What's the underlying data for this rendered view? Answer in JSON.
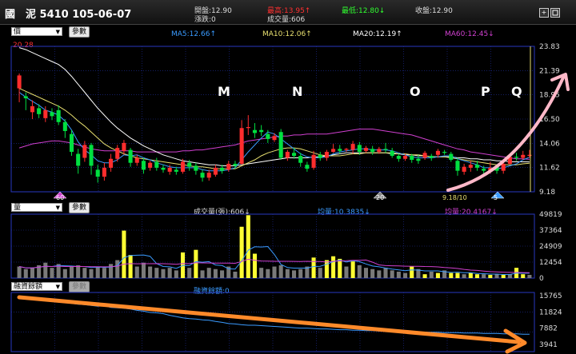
{
  "header": {
    "title": "國　泥 5410 105-06-07",
    "open_label": "開盤:",
    "open": "12.90",
    "high_label": "最高:",
    "high": "13.95↑",
    "low_label": "最低:",
    "low": "12.80↓",
    "close_label": "收盤:",
    "close": "12.90",
    "change_label": "漲跌:",
    "change": "0",
    "volume_label": "成交量:",
    "volume": "606",
    "plus_icon": "+",
    "restore_icon": "restore-icon"
  },
  "panel_price": {
    "selector": "價",
    "param_button": "參數",
    "ma5": "MA5:12.66↑",
    "ma10": "MA10:12.06↑",
    "ma20": "MA20:12.19↑",
    "ma60": "MA60:12.45↓",
    "top_left_value": "20.28",
    "y_ticks": [
      "23.83",
      "21.39",
      "18.95",
      "16.50",
      "14.06",
      "11.62",
      "9.18"
    ],
    "markers": {
      "left": "60",
      "mid": "20",
      "right": "5"
    },
    "low_label": "9.18/10",
    "letters": [
      "M",
      "N",
      "O",
      "P",
      "Q"
    ]
  },
  "panel_volume": {
    "selector": "量",
    "param_button": "參數",
    "vol_label": "成交量(張):606↓",
    "avg_short": "均量:10.3835↓",
    "avg_long": "均量:20.4167↓",
    "y_ticks": [
      "49819",
      "37364",
      "24909",
      "12454",
      "0"
    ]
  },
  "panel_margin": {
    "selector": "融資餘額",
    "param_button": "參數",
    "label": "融資餘額:0",
    "y_ticks": [
      "15765",
      "11824",
      "7882",
      "3941"
    ]
  },
  "colors": {
    "up": "#ff2d2d",
    "down": "#00e040",
    "ma5": "#3a9bff",
    "ma10": "#e8e070",
    "ma20": "#ffffff",
    "ma60": "#d040d0",
    "vol_hi": "#ffff33",
    "vol": "#7a7a7a",
    "grid": "#2030a0"
  },
  "chart_data": {
    "type": "candlestick",
    "y_range": [
      9.18,
      23.83
    ],
    "candles": [
      [
        19.6,
        20.9,
        21.1,
        18.2
      ],
      [
        18.8,
        18.6,
        19.2,
        17.4
      ],
      [
        17.2,
        17.8,
        18.4,
        16.5
      ],
      [
        17.6,
        17.0,
        18.0,
        16.6
      ],
      [
        16.6,
        17.4,
        17.8,
        16.2
      ],
      [
        17.2,
        16.8,
        17.6,
        16.4
      ],
      [
        17.4,
        16.2,
        17.9,
        15.9
      ],
      [
        16.2,
        15.3,
        16.5,
        14.6
      ],
      [
        15.0,
        13.2,
        15.4,
        12.8
      ],
      [
        13.0,
        11.8,
        13.5,
        11.0
      ],
      [
        12.6,
        13.9,
        14.3,
        12.2
      ],
      [
        13.9,
        11.8,
        14.1,
        10.9
      ],
      [
        11.4,
        10.7,
        11.9,
        10.1
      ],
      [
        10.7,
        11.6,
        12.1,
        10.3
      ],
      [
        11.6,
        12.5,
        13.0,
        11.2
      ],
      [
        12.5,
        13.6,
        13.9,
        12.2
      ],
      [
        13.3,
        14.1,
        14.4,
        12.9
      ],
      [
        13.4,
        12.1,
        13.6,
        11.7
      ],
      [
        12.1,
        12.6,
        12.9,
        11.8
      ],
      [
        12.3,
        11.4,
        12.6,
        11.0
      ],
      [
        11.6,
        12.1,
        12.3,
        11.3
      ],
      [
        12.2,
        11.6,
        12.6,
        11.3
      ],
      [
        11.6,
        11.4,
        11.9,
        11.1
      ],
      [
        11.2,
        11.6,
        11.9,
        10.9
      ],
      [
        11.4,
        11.2,
        11.7,
        10.9
      ],
      [
        11.2,
        12.2,
        12.5,
        11.0
      ],
      [
        12.1,
        11.7,
        12.4,
        11.3
      ],
      [
        11.8,
        11.3,
        12.1,
        10.9
      ],
      [
        11.1,
        10.6,
        11.4,
        10.2
      ],
      [
        10.6,
        11.1,
        11.4,
        10.3
      ],
      [
        10.9,
        11.6,
        11.9,
        10.7
      ],
      [
        11.6,
        11.3,
        11.9,
        11.0
      ],
      [
        11.4,
        12.0,
        12.3,
        11.2
      ],
      [
        12.0,
        11.8,
        12.3,
        11.5
      ],
      [
        12.0,
        15.6,
        16.4,
        11.9
      ],
      [
        15.6,
        15.7,
        16.9,
        14.9
      ],
      [
        15.4,
        15.1,
        16.1,
        14.6
      ],
      [
        15.4,
        15.2,
        15.9,
        14.8
      ],
      [
        15.0,
        14.5,
        15.4,
        14.1
      ],
      [
        14.4,
        14.8,
        15.1,
        14.2
      ],
      [
        15.2,
        12.6,
        15.5,
        12.4
      ],
      [
        12.6,
        13.2,
        13.4,
        12.3
      ],
      [
        13.1,
        12.8,
        13.6,
        12.5
      ],
      [
        12.8,
        12.1,
        13.1,
        11.7
      ],
      [
        11.9,
        11.5,
        12.2,
        11.2
      ],
      [
        11.6,
        12.9,
        13.3,
        11.4
      ],
      [
        12.9,
        12.6,
        13.2,
        12.3
      ],
      [
        12.6,
        13.2,
        13.4,
        12.3
      ],
      [
        13.2,
        13.5,
        14.0,
        13.1
      ],
      [
        13.5,
        13.3,
        13.9,
        13.0
      ],
      [
        13.4,
        13.5,
        13.6,
        13.2
      ],
      [
        13.4,
        14.0,
        14.3,
        13.0
      ],
      [
        13.9,
        13.2,
        14.2,
        12.9
      ],
      [
        13.3,
        13.6,
        13.8,
        13.1
      ],
      [
        13.5,
        13.2,
        13.8,
        12.9
      ],
      [
        13.2,
        13.5,
        13.7,
        13.0
      ],
      [
        13.5,
        13.4,
        14.1,
        13.1
      ],
      [
        13.3,
        12.8,
        13.6,
        12.6
      ],
      [
        12.8,
        12.5,
        13.0,
        12.2
      ],
      [
        12.5,
        12.8,
        13.0,
        12.3
      ],
      [
        12.8,
        12.4,
        13.0,
        12.1
      ],
      [
        12.5,
        12.3,
        12.9,
        12.0
      ],
      [
        12.6,
        13.1,
        13.3,
        12.4
      ],
      [
        12.8,
        12.6,
        13.0,
        12.3
      ],
      [
        12.9,
        13.3,
        13.5,
        12.6
      ],
      [
        13.2,
        13.1,
        13.4,
        12.9
      ],
      [
        13.0,
        12.4,
        13.2,
        12.2
      ],
      [
        12.3,
        11.3,
        12.6,
        10.8
      ],
      [
        11.2,
        11.7,
        12.0,
        10.9
      ],
      [
        11.6,
        11.9,
        12.3,
        11.2
      ],
      [
        11.9,
        11.6,
        12.3,
        11.3
      ],
      [
        11.5,
        11.3,
        11.8,
        11.0
      ],
      [
        11.2,
        11.6,
        12.2,
        11.0
      ],
      [
        11.7,
        11.3,
        11.9,
        11.0
      ],
      [
        11.3,
        12.0,
        12.3,
        11.0
      ],
      [
        12.0,
        12.7,
        13.0,
        11.9
      ],
      [
        12.7,
        12.6,
        13.1,
        12.3
      ],
      [
        12.6,
        12.9,
        13.3,
        12.4
      ],
      [
        12.8,
        12.9,
        13.4,
        12.6
      ]
    ],
    "ma5": [
      19.2,
      18.7,
      18.3,
      17.9,
      17.4,
      17.2,
      16.9,
      16.3,
      15.4,
      14.2,
      13.4,
      12.9,
      12.3,
      12.1,
      12.1,
      12.4,
      12.9,
      12.8,
      12.9,
      12.6,
      12.4,
      12.1,
      11.9,
      11.7,
      11.6,
      11.6,
      11.6,
      11.6,
      11.4,
      11.3,
      11.3,
      11.3,
      11.4,
      11.6,
      12.4,
      13.2,
      13.9,
      14.6,
      15.2,
      15.0,
      14.5,
      14.0,
      13.5,
      13.0,
      12.7,
      12.6,
      12.6,
      12.7,
      13.0,
      13.2,
      13.3,
      13.4,
      13.5,
      13.5,
      13.4,
      13.4,
      13.4,
      13.3,
      13.1,
      12.9,
      12.7,
      12.6,
      12.6,
      12.6,
      12.7,
      12.8,
      12.8,
      12.5,
      12.3,
      12.1,
      11.9,
      11.6,
      11.6,
      11.5,
      11.6,
      11.8,
      12.0,
      12.4,
      12.66
    ],
    "ma10": [
      19.6,
      19.3,
      19.0,
      18.7,
      18.4,
      18.1,
      17.8,
      17.4,
      16.9,
      16.3,
      15.8,
      15.2,
      14.6,
      14.0,
      13.6,
      13.3,
      13.0,
      12.8,
      12.6,
      12.5,
      12.4,
      12.3,
      12.2,
      12.1,
      12.0,
      11.9,
      11.8,
      11.7,
      11.7,
      11.6,
      11.5,
      11.5,
      11.5,
      11.5,
      11.8,
      12.1,
      12.4,
      12.8,
      13.1,
      13.3,
      13.5,
      13.6,
      13.6,
      13.5,
      13.3,
      13.1,
      12.9,
      12.8,
      12.8,
      12.8,
      12.9,
      13.0,
      13.0,
      13.1,
      13.1,
      13.1,
      13.1,
      13.1,
      13.0,
      13.0,
      12.9,
      12.9,
      12.8,
      12.7,
      12.7,
      12.7,
      12.6,
      12.5,
      12.4,
      12.3,
      12.2,
      12.1,
      12.0,
      11.9,
      11.9,
      11.9,
      11.9,
      12.0,
      12.06
    ],
    "ma20": [
      23.7,
      23.5,
      23.2,
      22.9,
      22.6,
      22.3,
      22.0,
      21.5,
      20.8,
      20.0,
      19.2,
      18.4,
      17.6,
      16.9,
      16.2,
      15.6,
      15.1,
      14.6,
      14.2,
      13.8,
      13.5,
      13.2,
      12.9,
      12.7,
      12.5,
      12.3,
      12.2,
      12.1,
      12.0,
      11.9,
      11.9,
      11.8,
      11.8,
      11.8,
      11.9,
      12.0,
      12.1,
      12.2,
      12.3,
      12.4,
      12.5,
      12.6,
      12.6,
      12.6,
      12.6,
      12.7,
      12.7,
      12.8,
      12.9,
      13.0,
      13.1,
      13.1,
      13.1,
      13.1,
      13.1,
      13.1,
      13.1,
      13.0,
      13.0,
      12.9,
      12.9,
      12.8,
      12.8,
      12.7,
      12.7,
      12.7,
      12.7,
      12.6,
      12.6,
      12.5,
      12.5,
      12.4,
      12.4,
      12.3,
      12.3,
      12.2,
      12.2,
      12.2,
      12.19
    ],
    "ma60": [
      13.6,
      13.8,
      14.0,
      14.1,
      14.2,
      14.3,
      14.3,
      14.2,
      14.1,
      13.9,
      13.7,
      13.5,
      13.4,
      13.3,
      13.3,
      13.3,
      13.3,
      13.3,
      13.2,
      13.2,
      13.2,
      13.2,
      13.2,
      13.2,
      13.2,
      13.3,
      13.3,
      13.4,
      13.4,
      13.5,
      13.6,
      13.7,
      13.8,
      13.9,
      14.1,
      14.3,
      14.4,
      14.5,
      14.6,
      14.7,
      14.8,
      14.8,
      14.9,
      14.9,
      15.0,
      15.0,
      15.0,
      15.0,
      15.1,
      15.2,
      15.3,
      15.4,
      15.5,
      15.5,
      15.5,
      15.4,
      15.3,
      15.2,
      15.1,
      15.0,
      14.9,
      14.7,
      14.5,
      14.3,
      14.1,
      13.9,
      13.7,
      13.5,
      13.4,
      13.2,
      13.1,
      13.0,
      12.9,
      12.8,
      12.7,
      12.6,
      12.5,
      12.5,
      12.45
    ],
    "volume": [
      9000,
      7000,
      8000,
      10000,
      12000,
      8000,
      11000,
      7000,
      9000,
      10000,
      8000,
      7000,
      9000,
      8000,
      11000,
      14000,
      37000,
      18000,
      9000,
      12000,
      9000,
      8000,
      7000,
      8000,
      6000,
      20000,
      8000,
      22000,
      6000,
      8000,
      7000,
      6000,
      9000,
      5000,
      40000,
      49000,
      19000,
      8000,
      7000,
      9000,
      10000,
      7000,
      6000,
      7000,
      9000,
      16000,
      8000,
      14000,
      17000,
      15000,
      9000,
      13000,
      10000,
      8000,
      7000,
      6000,
      8000,
      6000,
      5000,
      4000,
      9000,
      7000,
      3000,
      5000,
      4000,
      6000,
      4000,
      4000,
      3000,
      4000,
      3000,
      3000,
      2500,
      3000,
      2500,
      3000,
      8000,
      3000,
      2500
    ],
    "vol_hi": [
      0,
      0,
      0,
      0,
      0,
      0,
      0,
      0,
      0,
      0,
      0,
      0,
      0,
      0,
      0,
      0,
      1,
      1,
      0,
      0,
      0,
      0,
      0,
      0,
      0,
      1,
      0,
      1,
      0,
      0,
      0,
      0,
      0,
      0,
      1,
      1,
      1,
      0,
      0,
      0,
      0,
      0,
      0,
      0,
      0,
      1,
      0,
      1,
      1,
      1,
      0,
      1,
      0,
      0,
      0,
      0,
      0,
      0,
      0,
      0,
      1,
      0,
      1,
      0,
      1,
      0,
      1,
      1,
      0,
      1,
      1,
      0,
      1,
      0,
      1,
      0,
      1,
      1,
      0
    ],
    "margin_series": [
      15500,
      15400,
      15000,
      14900,
      14500,
      14600,
      14200,
      14300,
      13900,
      13700,
      13600,
      13400,
      13200,
      13300,
      12900,
      12800,
      12700,
      12500,
      12200,
      12000,
      11700,
      11600,
      11400,
      11000,
      10700,
      10400,
      10200,
      10100,
      9900,
      9800,
      9500,
      9300,
      9000,
      8900,
      8700,
      8600,
      8600,
      8500,
      8400,
      8300,
      8200,
      8100,
      8000,
      7900,
      7900,
      7800,
      7700,
      7700,
      7600,
      7500,
      7500,
      7400,
      7400,
      7300,
      7300,
      7200,
      7200,
      7100,
      7100,
      7000,
      7000,
      7000,
      6900,
      6900,
      6900,
      6800,
      6800,
      6800,
      6700,
      6700,
      6700,
      6600,
      6600,
      6600,
      6500,
      6500,
      6500,
      6400,
      6400
    ]
  }
}
